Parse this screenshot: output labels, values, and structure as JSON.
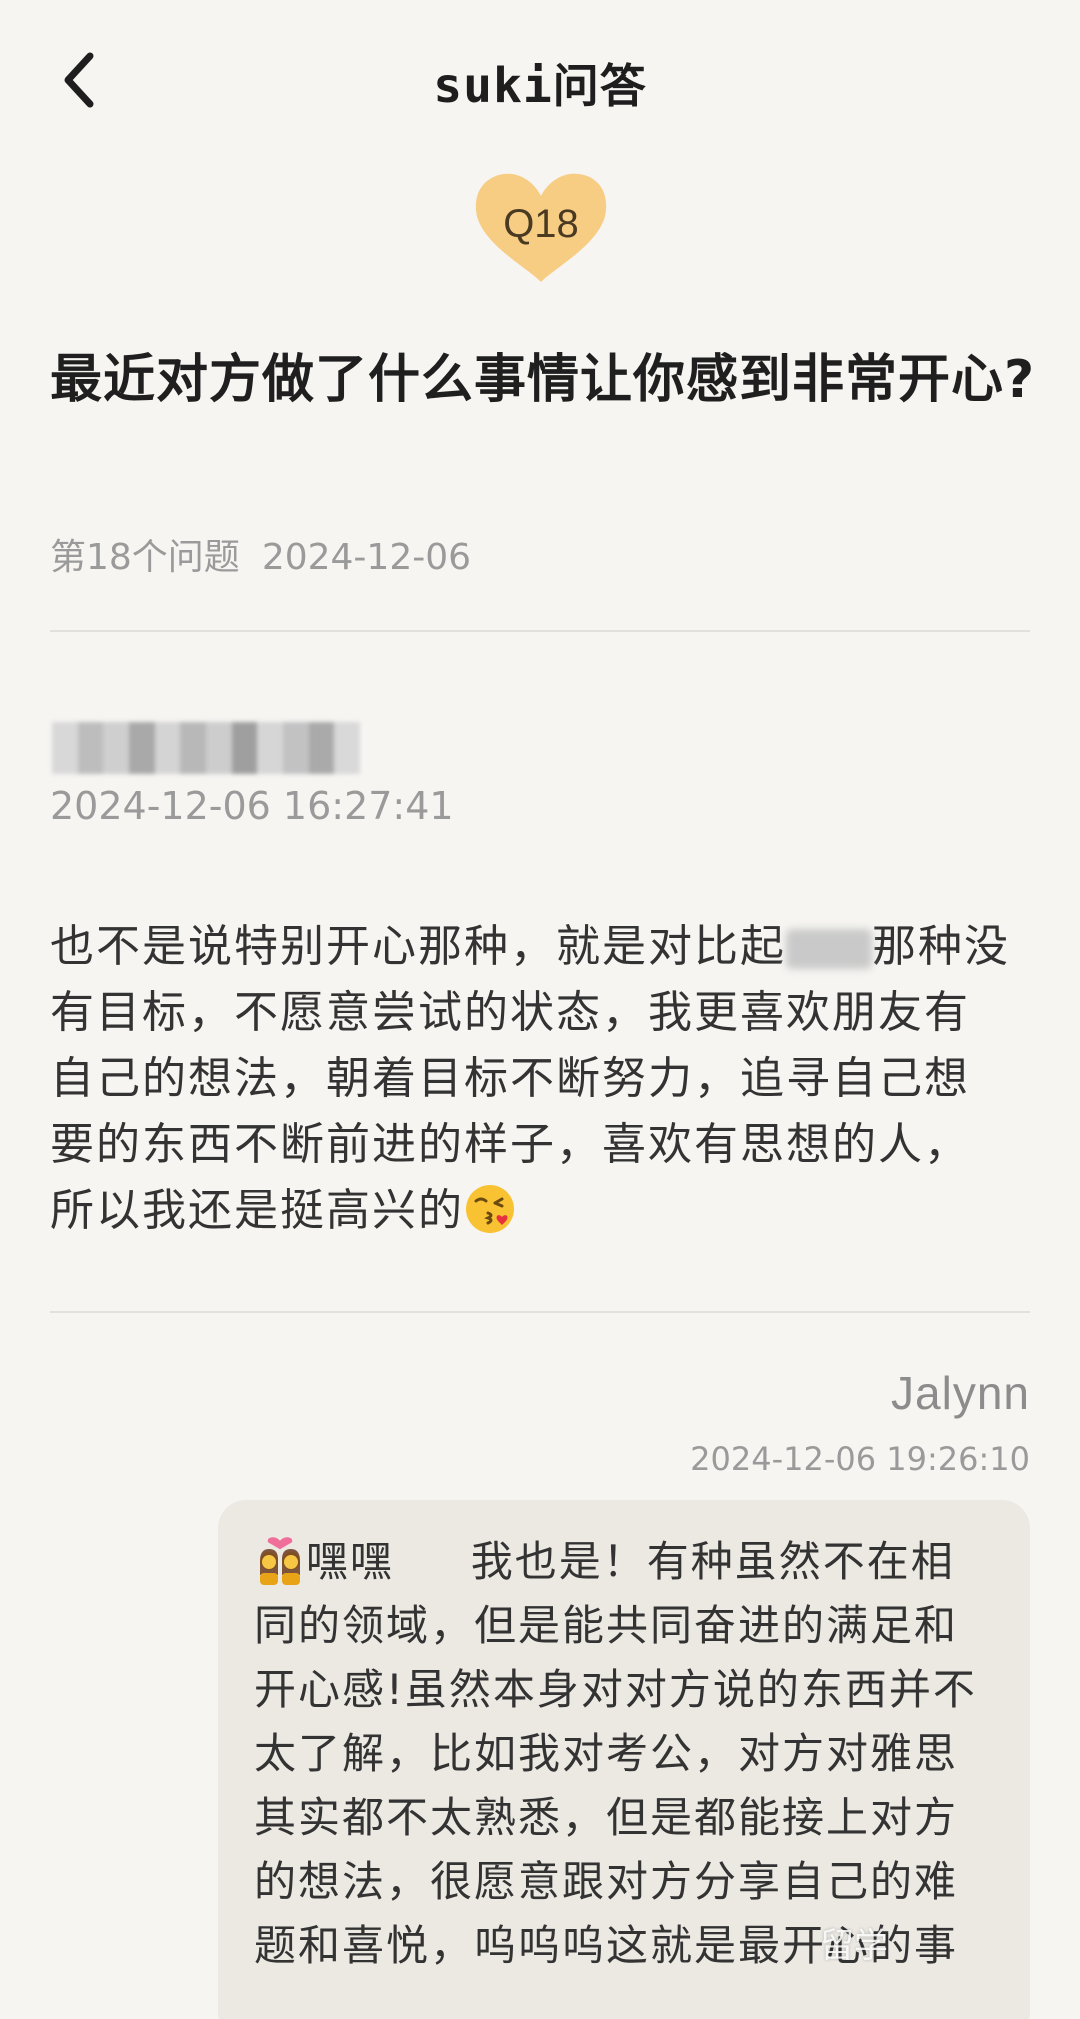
{
  "header": {
    "logo": "suki",
    "title": "问答"
  },
  "question": {
    "badge": "Q18",
    "text": "最近对方做了什么事情让你感到非常开心?",
    "number_label": "第18个问题",
    "date": "2024-12-06"
  },
  "answers": [
    {
      "timestamp": "2024-12-06 16:27:41",
      "text_part1": "也不是说特别开心那种，就是对比起",
      "text_part2": "那种没有目标，不愿意尝试的状态，我更喜欢朋友有自己的想法，朝着目标不断努力，追寻自己想要的东西不断前进的样子，喜欢有思想的人，所以我还是挺高兴的",
      "emoji": "face-blowing-kiss"
    },
    {
      "author": "Jalynn",
      "timestamp": "2024-12-06 19:26:10",
      "emoji": "couple-with-heart",
      "text": "嘿嘿     我也是！有种虽然不在相同的领域，但是能共同奋进的满足和开心感!虽然本身对对方说的东西并不太了解，比如我对考公，对方对雅思其实都不太熟悉，但是都能接上对方的想法，很愿意跟对方分享自己的难题和喜悦，呜呜呜这就是最开心的事"
    }
  ],
  "watermark": "留学",
  "colors": {
    "background": "#f6f5f2",
    "badge": "#f7c978",
    "bubble": "#ece9e3",
    "muted_text": "#9a9a9a"
  }
}
